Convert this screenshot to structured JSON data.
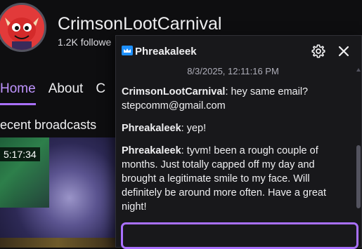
{
  "channel": {
    "name": "CrimsonLootCarnival",
    "followers": "1.2K followe"
  },
  "nav": {
    "tabs": [
      {
        "label": "Home",
        "active": true
      },
      {
        "label": "About",
        "active": false
      },
      {
        "label": "C",
        "active": false
      }
    ]
  },
  "section": {
    "title": "ecent broadcasts"
  },
  "video": {
    "duration": "5:17:34"
  },
  "popover": {
    "username": "Phreakaleek",
    "badge_icon": "crown-icon",
    "timestamp": "8/3/2025, 12:11:16 PM",
    "messages": [
      {
        "author": "CrimsonLootCarnival",
        "text": ": hey same email? stepcomm@gmail.com"
      },
      {
        "author": "Phreakaleek",
        "text": ": yep!"
      },
      {
        "author": "Phreakaleek",
        "text": ": tyvm! been a rough couple of months. Just totally capped off my day and brought a legitimate smile to my face. Will definitely be around more often. Have a great night!"
      }
    ],
    "reply_value": ""
  },
  "colors": {
    "accent": "#a970ff",
    "background": "#0e0e10",
    "popover_bg": "#18181b",
    "avatar_red": "#e23a3a"
  }
}
